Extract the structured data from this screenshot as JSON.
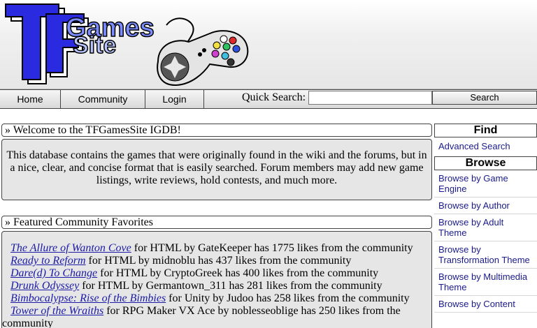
{
  "header": {
    "logo_text": "TFGamesSite"
  },
  "nav": {
    "home": "Home",
    "community": "Community",
    "login": "Login",
    "quick_search_label": "Quick Search:",
    "search_value": "",
    "search_button": "Search"
  },
  "welcome": {
    "title": "» Welcome to the TFGamesSite IGDB!",
    "text": "This database contains the games that were originally found in the wiki and the forums, but in a nice, clear, and concise format that is easily searched. Forum members may add new game listings, write reviews, hold contests, and much more."
  },
  "featured": {
    "title": "» Featured Community Favorites",
    "items": [
      {
        "game": "The Allure of Wanton Cove",
        "rest": " for HTML by GateKeeper has 1775 likes from the community"
      },
      {
        "game": "Ready to Reform",
        "rest": " for HTML by midnoblu has 437 likes from the community"
      },
      {
        "game": "Dare(d) To Change",
        "rest": " for HTML by CryptoGreek has 400 likes from the community"
      },
      {
        "game": "Drunk Odyssey",
        "rest": " for HTML by Germantown_311 has 281 likes from the community"
      },
      {
        "game": "Bimbocalypse: Rise of the Bimbies",
        "rest": " for Unity by Judoo has 258 likes from the community"
      },
      {
        "game": "Tower of the Wraiths",
        "rest": " for RPG Maker VX Ace by noblesseoblige has 250 likes from the"
      },
      {
        "game": "",
        "rest": "community"
      }
    ]
  },
  "sidebar": {
    "find_heading": "Find",
    "advanced_search": "Advanced Search",
    "browse_heading": "Browse",
    "links": [
      "Browse by Game Engine",
      "Browse by Author",
      "Browse by Adult Theme",
      "Browse by Transformation Theme",
      "Browse by Multimedia Theme",
      "Browse by Content"
    ]
  }
}
